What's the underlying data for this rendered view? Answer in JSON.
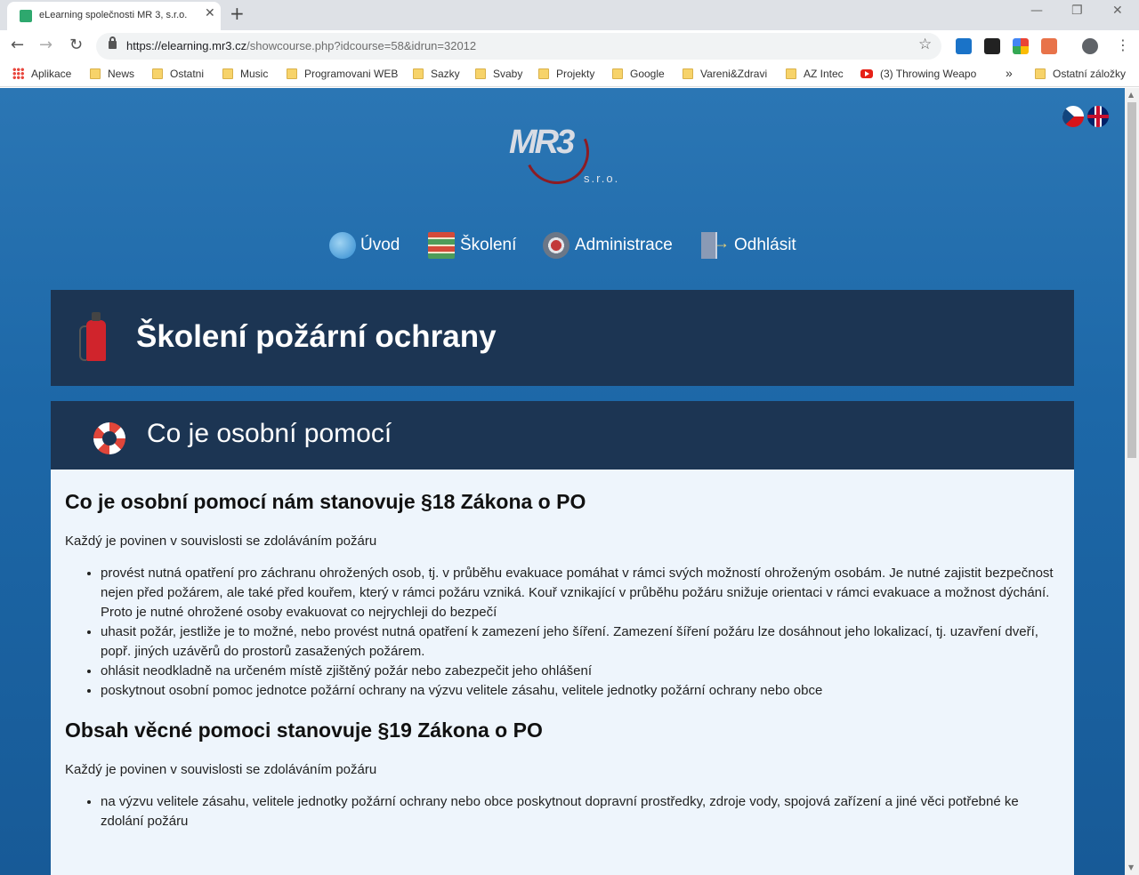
{
  "browser": {
    "tab_title": "eLearning společnosti MR 3, s.r.o.",
    "url_host": "https://elearning.mr3.cz",
    "url_path": "/showcourse.php?idcourse=58&idrun=32012",
    "bookmarks": [
      {
        "label": "Aplikace",
        "icon": "apps-icon"
      },
      {
        "label": "News",
        "icon": "folder-icon"
      },
      {
        "label": "Ostatni",
        "icon": "folder-icon"
      },
      {
        "label": "Music",
        "icon": "folder-icon"
      },
      {
        "label": "Programovani WEB",
        "icon": "folder-icon"
      },
      {
        "label": "Sazky",
        "icon": "folder-icon"
      },
      {
        "label": "Svaby",
        "icon": "folder-icon"
      },
      {
        "label": "Projekty",
        "icon": "folder-icon"
      },
      {
        "label": "Google",
        "icon": "folder-icon"
      },
      {
        "label": "Vareni&Zdravi",
        "icon": "folder-icon"
      },
      {
        "label": "AZ Intec",
        "icon": "folder-icon"
      },
      {
        "label": "(3) Throwing Weapo",
        "icon": "youtube-icon"
      },
      {
        "label": "»",
        "icon": "chevron-icon"
      },
      {
        "label": "Ostatní záložky",
        "icon": "folder-icon"
      }
    ]
  },
  "logo": {
    "text": "MR3",
    "suffix": "s.r.o."
  },
  "nav": [
    {
      "label": "Úvod",
      "icon": "globe-icon"
    },
    {
      "label": "Školení",
      "icon": "books-icon"
    },
    {
      "label": "Administrace",
      "icon": "gear-icon"
    },
    {
      "label": "Odhlásit",
      "icon": "logout-icon"
    }
  ],
  "page_title": "Školení požární ochrany",
  "section": {
    "title": "Co je osobní pomocí",
    "blocks": [
      {
        "heading": "Co je osobní pomocí nám stanovuje §18 Zákona o PO",
        "intro": "Každý je povinen v souvislosti se zdoláváním požáru",
        "items": [
          "provést nutná opatření pro záchranu ohrožených osob, tj. v průběhu evakuace pomáhat v rámci svých možností ohroženým osobám. Je nutné zajistit bezpečnost nejen před požárem, ale také před kouřem, který v rámci požáru vzniká. Kouř vznikající v průběhu požáru snižuje orientaci v rámci evakuace a možnost dýchání. Proto je nutné ohrožené osoby evakuovat co nejrychleji do bezpečí",
          "uhasit požár, jestliže je to možné, nebo provést nutná opatření k zamezení jeho šíření. Zamezení šíření požáru lze dosáhnout jeho lokalizací, tj. uzavření dveří, popř. jiných uzávěrů do prostorů zasažených požárem.",
          "ohlásit neodkladně na určeném místě zjištěný požár nebo zabezpečit jeho ohlášení",
          "poskytnout osobní pomoc jednotce požární ochrany na výzvu velitele zásahu, velitele jednotky požární ochrany nebo obce"
        ]
      },
      {
        "heading": "Obsah věcné pomoci stanovuje §19 Zákona o PO",
        "intro": "Každý je povinen v souvislosti se zdoláváním požáru",
        "items": [
          "na výzvu velitele zásahu, velitele jednotky požární ochrany nebo obce poskytnout dopravní prostředky, zdroje vody, spojová zařízení a jiné věci potřebné ke zdolání požáru"
        ]
      }
    ]
  }
}
